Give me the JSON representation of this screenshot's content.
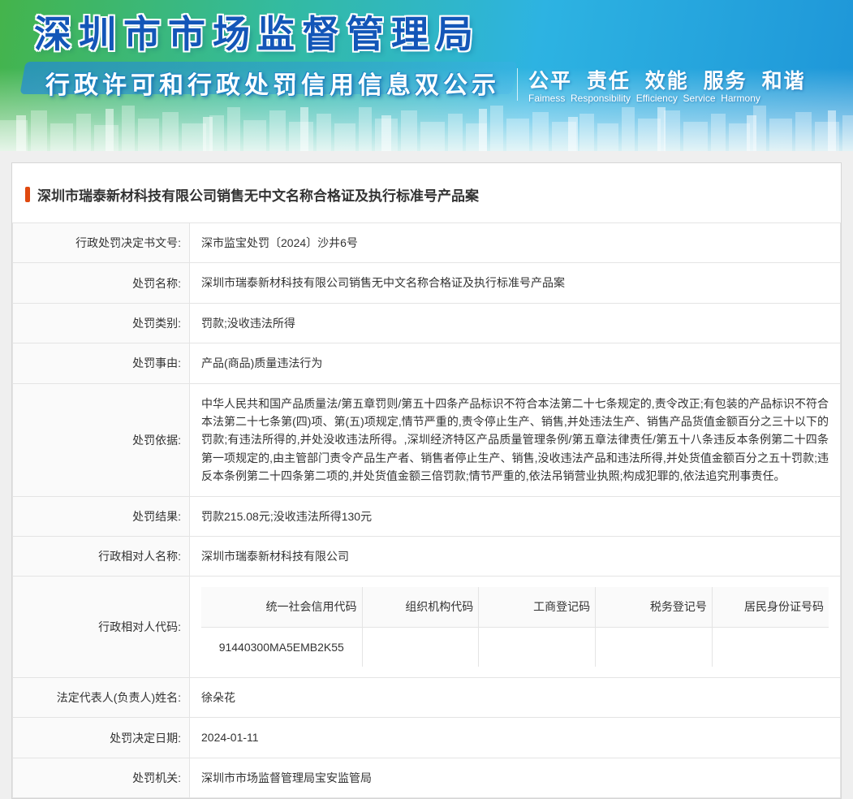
{
  "colors": {
    "accent": "#e0490f",
    "title-blue": "#1356b8"
  },
  "header": {
    "agency_title": "深圳市市场监督管理局",
    "banner_subtitle": "行政许可和行政处罚信用信息双公示",
    "slogan_cn": "公平  责任  效能  服务  和谐",
    "slogan_en": "Faimess  Responsibility  Efficiency  Service  Harmony"
  },
  "content": {
    "case_title": "深圳市瑞泰新材科技有限公司销售无中文名称合格证及执行标准号产品案",
    "rows": [
      {
        "label": "行政处罚决定书文号:",
        "value": "深市监宝处罚〔2024〕沙井6号"
      },
      {
        "label": "处罚名称:",
        "value": "深圳市瑞泰新材科技有限公司销售无中文名称合格证及执行标准号产品案"
      },
      {
        "label": "处罚类别:",
        "value": "罚款;没收违法所得"
      },
      {
        "label": "处罚事由:",
        "value": "产品(商品)质量违法行为"
      },
      {
        "label": "处罚依据:",
        "value": "中华人民共和国产品质量法/第五章罚则/第五十四条产品标识不符合本法第二十七条规定的,责令改正;有包装的产品标识不符合本法第二十七条第(四)项、第(五)项规定,情节严重的,责令停止生产、销售,并处违法生产、销售产品货值金额百分之三十以下的罚款;有违法所得的,并处没收违法所得。,深圳经济特区产品质量管理条例/第五章法律责任/第五十八条违反本条例第二十四条第一项规定的,由主管部门责令产品生产者、销售者停止生产、销售,没收违法产品和违法所得,并处货值金额百分之五十罚款;违反本条例第二十四条第二项的,并处货值金额三倍罚款;情节严重的,依法吊销营业执照;构成犯罪的,依法追究刑事责任。"
      },
      {
        "label": "处罚结果:",
        "value": "罚款215.08元;没收违法所得130元"
      },
      {
        "label": "行政相对人名称:",
        "value": "深圳市瑞泰新材科技有限公司"
      },
      {
        "label": "法定代表人(负责人)姓名:",
        "value": "徐朵花"
      },
      {
        "label": "处罚决定日期:",
        "value": "2024-01-11"
      },
      {
        "label": "处罚机关:",
        "value": "深圳市市场监督管理局宝安监管局"
      }
    ],
    "code_table": {
      "label": "行政相对人代码:",
      "headers": [
        "统一社会信用代码",
        "组织机构代码",
        "工商登记码",
        "税务登记号",
        "居民身份证号码"
      ],
      "values": [
        "91440300MA5EMB2K55",
        "",
        "",
        "",
        ""
      ]
    }
  }
}
